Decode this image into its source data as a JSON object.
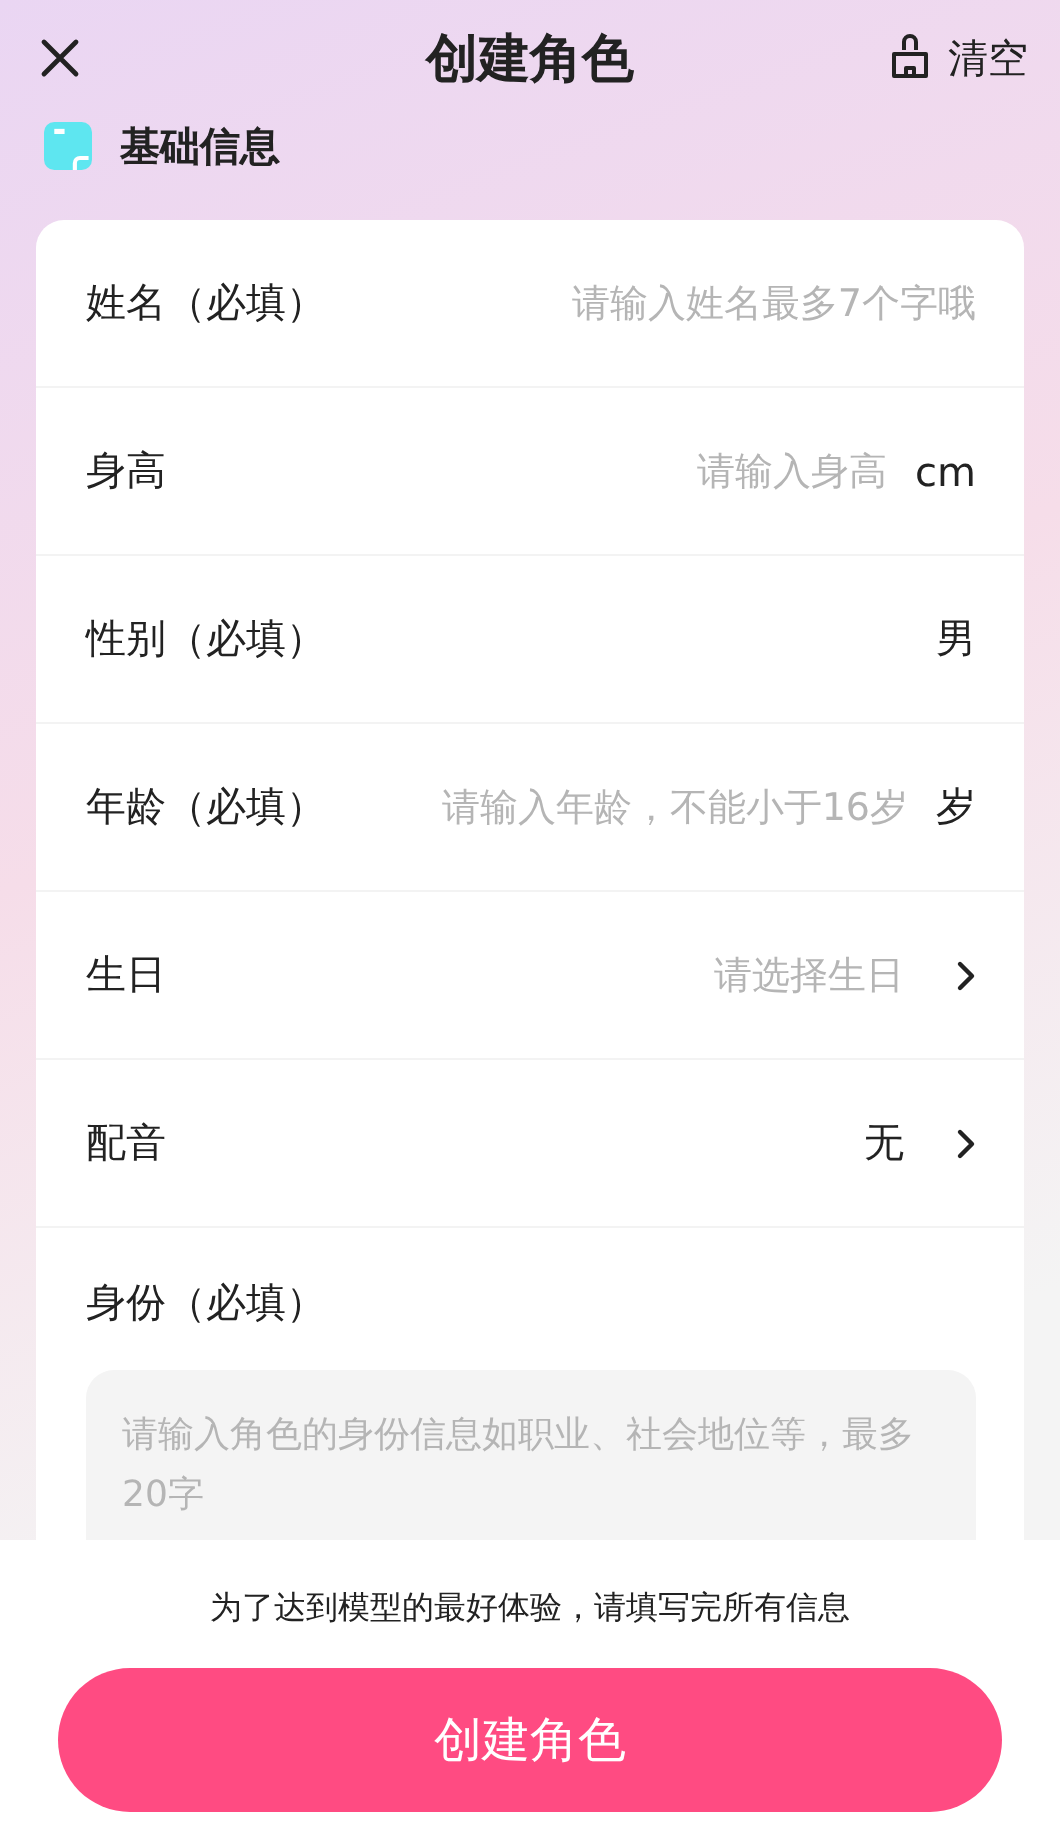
{
  "header": {
    "title": "创建角色",
    "clear_label": "清空"
  },
  "section": {
    "title": "基础信息"
  },
  "fields": [
    {
      "kind": "input",
      "label": "姓名（必填）",
      "placeholder": "请输入姓名最多7个字哦"
    },
    {
      "kind": "input",
      "label": "身高",
      "placeholder": "请输入身高",
      "unit": "cm"
    },
    {
      "kind": "value",
      "label": "性别（必填）",
      "value": "男"
    },
    {
      "kind": "input",
      "label": "年龄（必填）",
      "placeholder": "请输入年龄，不能小于16岁",
      "unit": "岁"
    },
    {
      "kind": "picker",
      "label": "生日",
      "placeholder": "请选择生日"
    },
    {
      "kind": "picker",
      "label": "配音",
      "value": "无"
    }
  ],
  "identity": {
    "label": "身份（必填）",
    "placeholder": "请输入角色的身份信息如职业、社会地位等，最多20字"
  },
  "footer": {
    "hint": "为了达到模型的最好体验，请填写完所有信息",
    "button": "创建角色"
  }
}
